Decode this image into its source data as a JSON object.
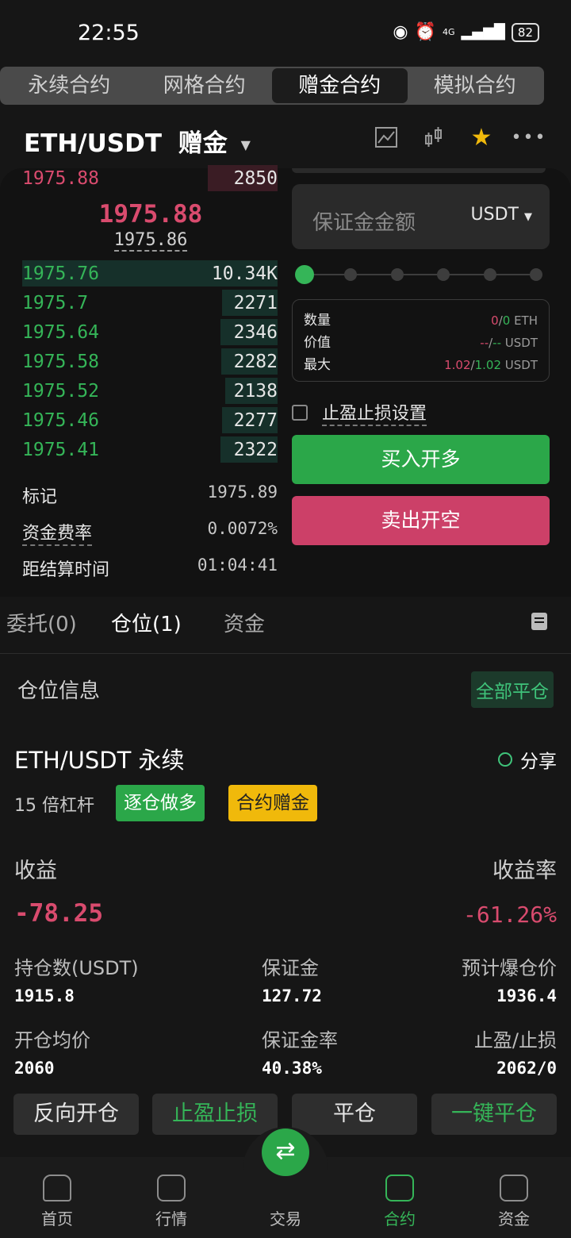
{
  "status_bar": {
    "time": "22:55",
    "battery": "82",
    "network": "4G"
  },
  "top_tabs": [
    "永续合约",
    "网格合约",
    "赠金合约",
    "模拟合约"
  ],
  "header": {
    "pair": "ETH/USDT",
    "label": "赠金"
  },
  "order_book": {
    "ask_top": {
      "price": "1975.88",
      "qty": "2850"
    },
    "last_price": "1975.88",
    "index_price": "1975.86",
    "bids": [
      {
        "price": "1975.76",
        "qty": "10.34K"
      },
      {
        "price": "1975.7",
        "qty": "2271"
      },
      {
        "price": "1975.64",
        "qty": "2346"
      },
      {
        "price": "1975.58",
        "qty": "2282"
      },
      {
        "price": "1975.52",
        "qty": "2138"
      },
      {
        "price": "1975.46",
        "qty": "2277"
      },
      {
        "price": "1975.41",
        "qty": "2322"
      }
    ],
    "mark": {
      "label": "标记",
      "value": "1975.89"
    },
    "funding": {
      "label": "资金费率",
      "value": "0.0072%"
    },
    "settle": {
      "label": "距结算时间",
      "value": "01:04:41"
    }
  },
  "order_form": {
    "margin_placeholder": "保证金金额",
    "unit": "USDT",
    "info": {
      "qty_label": "数量",
      "qty_a": "0",
      "qty_b": "0",
      "qty_unit": "ETH",
      "value_label": "价值",
      "value_a": "--",
      "value_b": "--",
      "value_unit": "USDT",
      "max_label": "最大",
      "max_a": "1.02",
      "max_b": "1.02",
      "max_unit": "USDT"
    },
    "tpsl_label": "止盈止损设置",
    "buy_label": "买入开多",
    "sell_label": "卖出开空"
  },
  "sub_tabs": {
    "orders": "委托(0)",
    "positions": "仓位(1)",
    "funds": "资金"
  },
  "position": {
    "section_title": "仓位信息",
    "close_all": "全部平仓",
    "title": "ETH/USDT 永续",
    "share": "分享",
    "leverage": "15 倍杠杆",
    "badge_long": "逐仓做多",
    "badge_bonus": "合约赠金",
    "pnl_label": "收益",
    "pnl_value": "-78.25",
    "pnl_rate_label": "收益率",
    "pnl_rate_value": "-61.26%",
    "size_label": "持仓数(USDT)",
    "size_value": "1915.8",
    "margin_label": "保证金",
    "margin_value": "127.72",
    "liq_label": "预计爆仓价",
    "liq_value": "1936.4",
    "entry_label": "开仓均价",
    "entry_value": "2060",
    "margin_rate_label": "保证金率",
    "margin_rate_value": "40.38%",
    "tpsl_label": "止盈/止损",
    "tpsl_value": "2062/0"
  },
  "actions": [
    "反向开仓",
    "止盈止损",
    "平仓",
    "一键平仓"
  ],
  "bottom_nav": [
    "首页",
    "行情",
    "交易",
    "合约",
    "资金"
  ],
  "colors": {
    "up": "#35b558",
    "down": "#d94b6e",
    "bonus": "#f0b90b"
  },
  "slider": {
    "value_percent": 0
  }
}
